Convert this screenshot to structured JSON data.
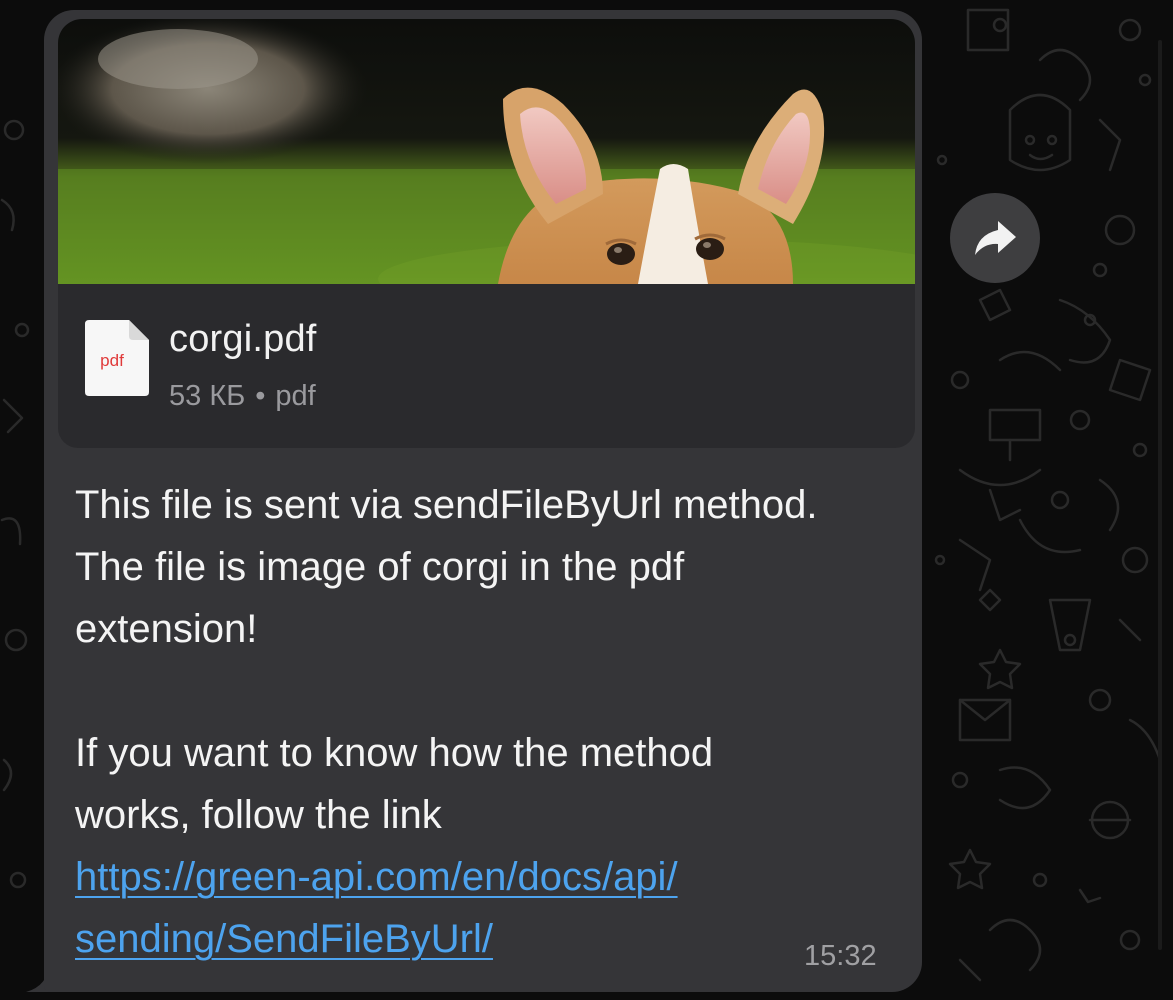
{
  "message": {
    "file": {
      "name": "corgi.pdf",
      "size": "53 КБ",
      "separator": "•",
      "type": "pdf",
      "icon_label": "pdf"
    },
    "paragraph1": "This file is sent via sendFileByUrl method. The file is image of corgi in the pdf extension!",
    "paragraph2_lines": [
      "If you want to know how the method",
      "works, follow the link"
    ],
    "link_lines": [
      "https://green-api.com/en/docs/api/",
      "sending/SendFileByUrl/"
    ],
    "time": "15:32"
  },
  "colors": {
    "bubble": "#353538",
    "file_card": "#2a2a2d",
    "link": "#4da3ee",
    "background": "#0c0c0c",
    "pdf_label": "#e03a3a"
  },
  "icons": {
    "forward": "forward-arrow-icon",
    "file": "pdf-file-icon"
  }
}
